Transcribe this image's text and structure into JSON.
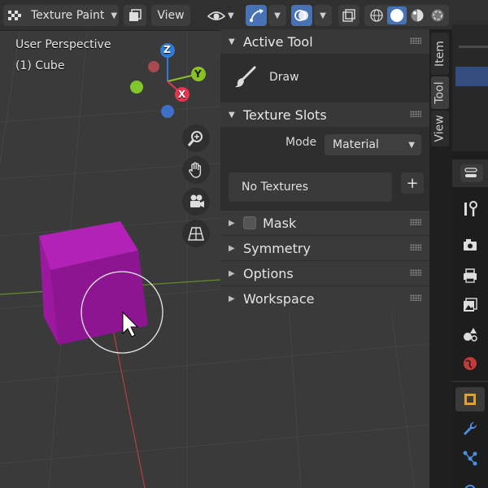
{
  "header": {
    "mode_label": "Texture Paint",
    "view_label": "View"
  },
  "viewport": {
    "perspective_label": "User Perspective",
    "object_label": "(1) Cube",
    "gizmo": {
      "x": "X",
      "y": "Y",
      "z": "Z"
    }
  },
  "panel": {
    "active_tool": {
      "title": "Active Tool",
      "tool_name": "Draw"
    },
    "texture_slots": {
      "title": "Texture Slots",
      "mode_label": "Mode",
      "mode_value": "Material",
      "list_text": "No Textures",
      "add_label": "+"
    },
    "subpanels": {
      "mask": "Mask",
      "symmetry": "Symmetry",
      "options": "Options",
      "workspace": "Workspace"
    }
  },
  "tabs": {
    "item": "Item",
    "tool": "Tool",
    "view": "View"
  },
  "colors": {
    "accent": "#4772b3",
    "cube": "#a31aa6",
    "axis_x": "#e8344f",
    "axis_y": "#8bc128",
    "axis_z": "#2f7bd6"
  }
}
